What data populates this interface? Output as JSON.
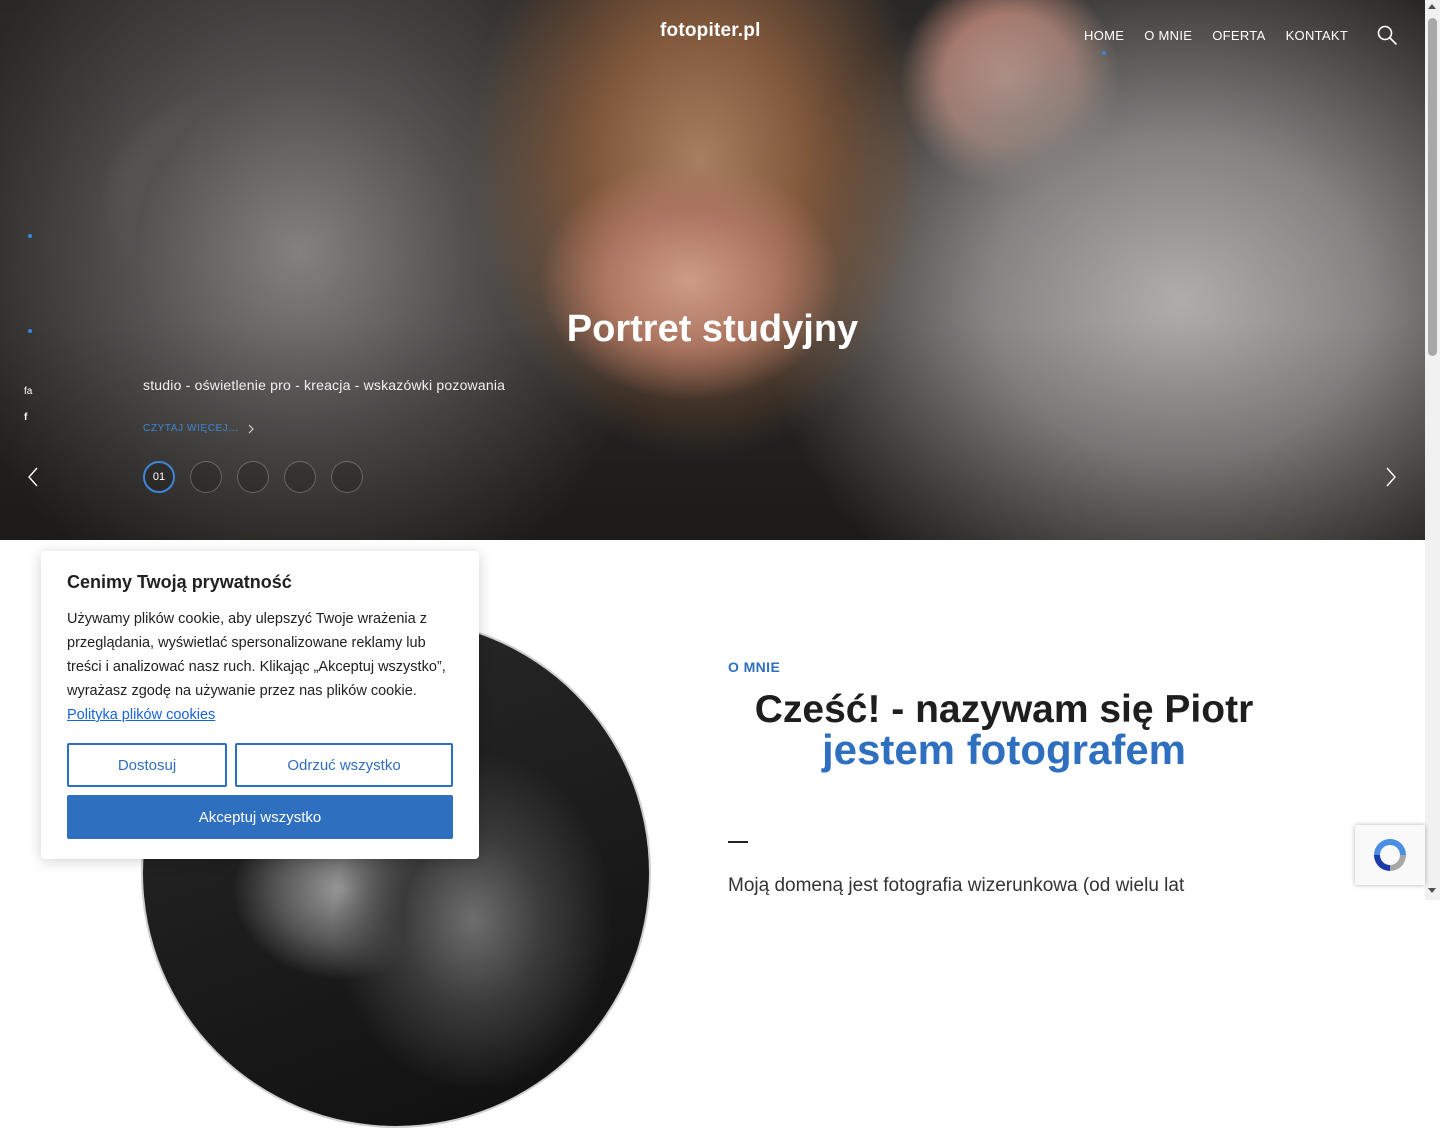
{
  "header": {
    "logo": "fotopiter.pl",
    "nav": [
      "HOME",
      "O MNIE",
      "OFERTA",
      "KONTAKT"
    ],
    "active_nav": "HOME"
  },
  "hero": {
    "title": "Portret studyjny",
    "subtitle": "studio - oświetlenie pro - kreacja - wskazówki pozowania",
    "more": "CZYTAJ WIĘCEJ...",
    "side_share": [
      "fa",
      "f"
    ],
    "slides": [
      "01",
      "",
      "",
      "",
      ""
    ],
    "active_slide": 0
  },
  "cookie": {
    "title": "Cenimy Twoją prywatność",
    "text": "Używamy plików cookie, aby ulepszyć Twoje wrażenia z przeglądania, wyświetlać spersonalizowane reklamy lub treści i analizować nasz ruch. Klikając „Akceptuj wszystko”, wyrażasz zgodę na używanie przez nas plików cookie.",
    "link": "Polityka plików cookies",
    "customize": "Dostosuj",
    "reject": "Odrzuć wszystko",
    "accept": "Akceptuj wszystko"
  },
  "about": {
    "eyebrow": "O MNIE",
    "heading": "Cześć! - nazywam się Piotr",
    "heading_accent": "jestem fotografem",
    "paragraph": "Moją domeną jest fotografia wizerunkowa (od wielu lat"
  },
  "colors": {
    "accent": "#2f6fbf",
    "link": "#1863dc",
    "active_dot": "#3b86d8"
  },
  "icons": {
    "search": "search-icon",
    "prev": "chevron-left-icon",
    "next": "chevron-right-icon",
    "recaptcha": "recaptcha-icon"
  }
}
